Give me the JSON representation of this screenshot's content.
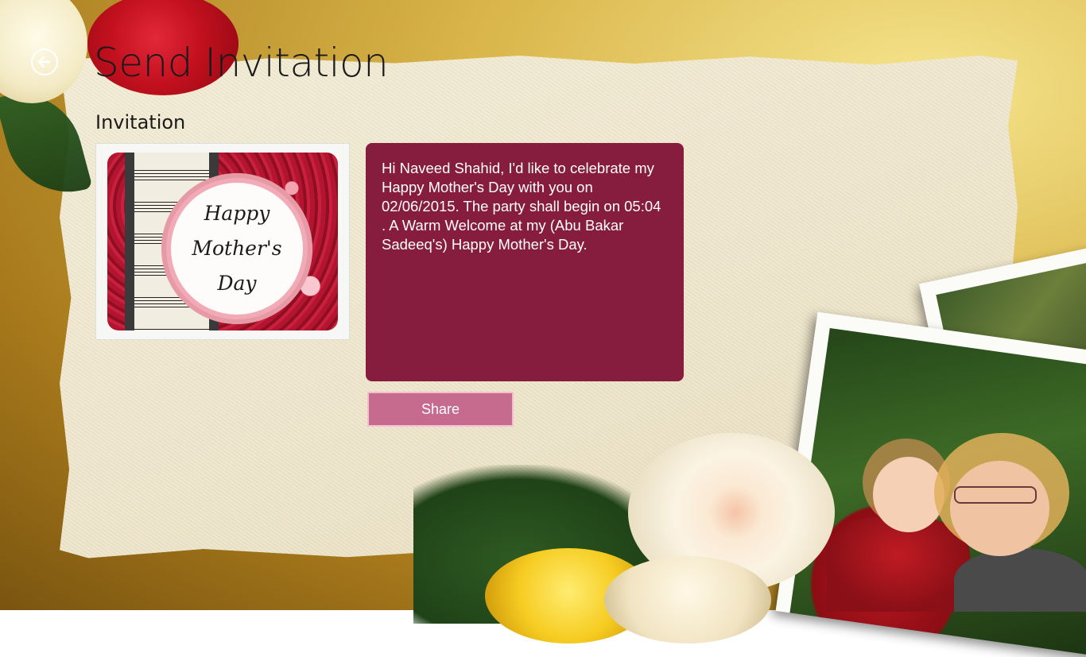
{
  "page": {
    "title": "Send Invitation",
    "section_label": "Invitation",
    "back_icon": "back-arrow-icon"
  },
  "card": {
    "line1": "Happy",
    "line2": "Mother's",
    "line3": "Day"
  },
  "message": {
    "text": "Hi Naveed Shahid, I'd like to celebrate my Happy Mother's Day with you on 02/06/2015. The party shall begin on 05:04 . A Warm Welcome at my (Abu Bakar Sadeeq's) Happy Mother's Day."
  },
  "actions": {
    "share_label": "Share"
  },
  "colors": {
    "message_bg": "#861c3e",
    "share_bg": "#c66b8e",
    "share_border": "#f3bfd0"
  }
}
